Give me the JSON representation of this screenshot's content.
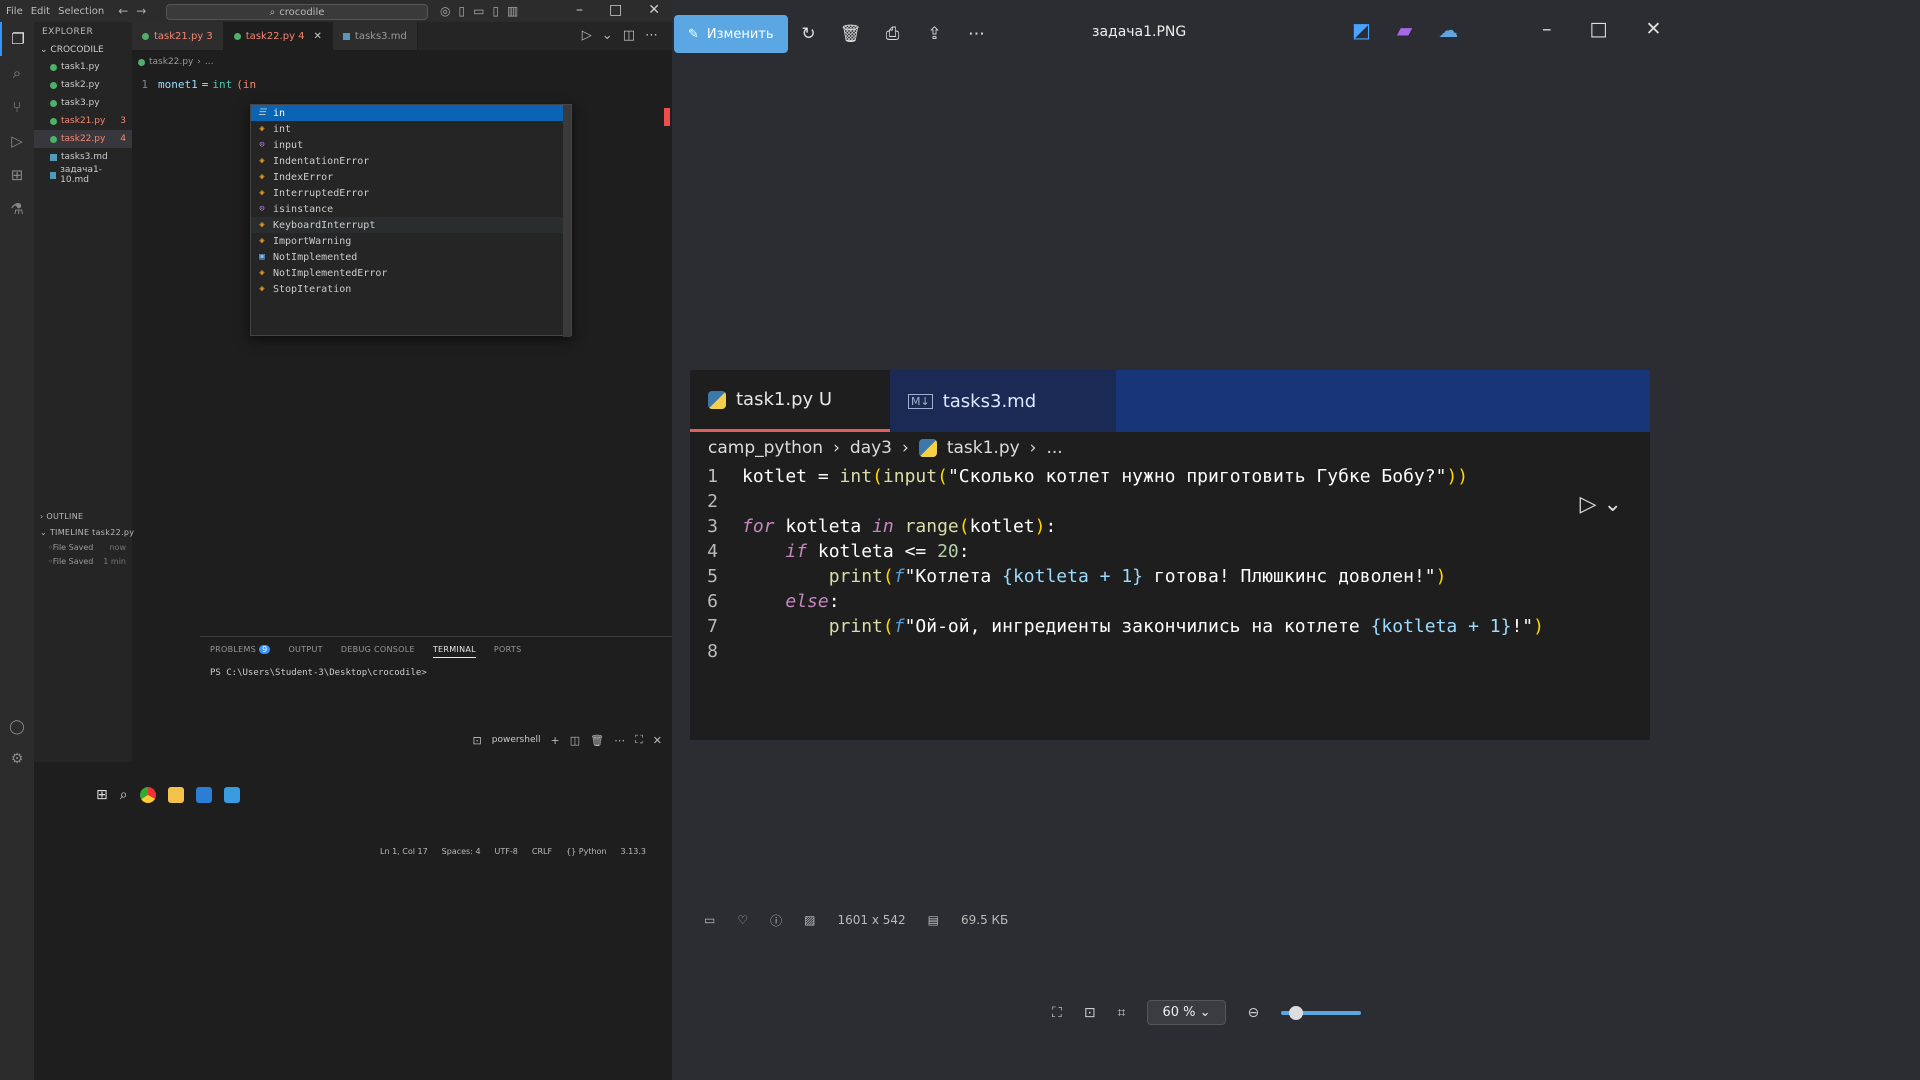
{
  "vscode": {
    "menu": [
      "File",
      "Edit",
      "Selection"
    ],
    "command_center": "crocodile",
    "explorer_header": "EXPLORER",
    "folder_name": "CROCODILE",
    "files": [
      {
        "name": "task1.py",
        "kind": "py",
        "state": "normal",
        "badge": ""
      },
      {
        "name": "task2.py",
        "kind": "py",
        "state": "normal",
        "badge": ""
      },
      {
        "name": "task3.py",
        "kind": "py",
        "state": "normal",
        "badge": ""
      },
      {
        "name": "task21.py",
        "kind": "py",
        "state": "err",
        "badge": "3"
      },
      {
        "name": "task22.py",
        "kind": "py",
        "state": "active-err",
        "badge": "4"
      },
      {
        "name": "tasks3.md",
        "kind": "md",
        "state": "normal",
        "badge": ""
      },
      {
        "name": "задача1-10.md",
        "kind": "md",
        "state": "normal",
        "badge": ""
      }
    ],
    "outline_label": "OUTLINE",
    "timeline_label": "TIMELINE",
    "timeline_file": "task22.py",
    "timeline_items": [
      {
        "label": "File Saved",
        "time": "now"
      },
      {
        "label": "File Saved",
        "time": "1 min"
      }
    ],
    "tabs": [
      {
        "label": "task21.py 3",
        "state": "err"
      },
      {
        "label": "task22.py 4",
        "state": "active"
      },
      {
        "label": "tasks3.md",
        "state": "normal"
      }
    ],
    "breadcrumb": [
      "task22.py",
      "..."
    ],
    "code_line": {
      "num": "1",
      "var": "monet1",
      "op": "=",
      "fn": "int",
      "typed": "(in"
    },
    "suggestions": [
      {
        "label": "in",
        "icon": "kw",
        "glyph": "☰"
      },
      {
        "label": "int",
        "icon": "class",
        "glyph": "◈"
      },
      {
        "label": "input",
        "icon": "func",
        "glyph": "⊙"
      },
      {
        "label": "IndentationError",
        "icon": "class",
        "glyph": "◈"
      },
      {
        "label": "IndexError",
        "icon": "class",
        "glyph": "◈"
      },
      {
        "label": "InterruptedError",
        "icon": "class",
        "glyph": "◈"
      },
      {
        "label": "isinstance",
        "icon": "func",
        "glyph": "⊙"
      },
      {
        "label": "KeyboardInterrupt",
        "icon": "class",
        "glyph": "◈"
      },
      {
        "label": "ImportWarning",
        "icon": "class",
        "glyph": "◈"
      },
      {
        "label": "NotImplemented",
        "icon": "const",
        "glyph": "▣"
      },
      {
        "label": "NotImplementedError",
        "icon": "class",
        "glyph": "◈"
      },
      {
        "label": "StopIteration",
        "icon": "class",
        "glyph": "◈"
      }
    ],
    "panel_tabs": [
      "PROBLEMS",
      "OUTPUT",
      "DEBUG CONSOLE",
      "TERMINAL",
      "PORTS"
    ],
    "problems_count": "9",
    "terminal_prompt": "PS C:\\Users\\Student-3\\Desktop\\crocodile>",
    "terminal_shell": "powershell",
    "status": [
      "Ln 1, Col 17",
      "Spaces: 4",
      "UTF-8",
      "CRLF",
      "{} Python",
      "3.13.3"
    ]
  },
  "viewer": {
    "edit_label": "Изменить",
    "title": "задача1.PNG",
    "image_tabs": [
      {
        "label": "task1.py U",
        "active": true
      },
      {
        "label": "tasks3.md",
        "active": false
      }
    ],
    "image_breadcrumb": [
      "camp_python",
      "day3",
      "task1.py",
      "..."
    ],
    "code_lines": [
      {
        "n": "1",
        "segments": [
          [
            "nm",
            "kotlet "
          ],
          [
            "nm",
            "= "
          ],
          [
            "bi",
            "int"
          ],
          [
            "br",
            "("
          ],
          [
            "bi",
            "input"
          ],
          [
            "br",
            "("
          ],
          [
            "st",
            "\"Сколько котлет нужно приготовить Губке Бобу?\""
          ],
          [
            "br",
            "))"
          ]
        ]
      },
      {
        "n": "2",
        "segments": []
      },
      {
        "n": "3",
        "segments": [
          [
            "kw",
            "for "
          ],
          [
            "nm",
            "kotleta "
          ],
          [
            "kw",
            "in "
          ],
          [
            "bi",
            "range"
          ],
          [
            "br",
            "("
          ],
          [
            "nm",
            "kotlet"
          ],
          [
            "br",
            ")"
          ],
          [
            "nm",
            ":"
          ]
        ]
      },
      {
        "n": "4",
        "segments": [
          [
            "ind",
            "    "
          ],
          [
            "kw",
            "if "
          ],
          [
            "nm",
            "kotleta "
          ],
          [
            "nm",
            "<= "
          ],
          [
            "num",
            "20"
          ],
          [
            "nm",
            ":"
          ]
        ]
      },
      {
        "n": "5",
        "segments": [
          [
            "ind",
            "        "
          ],
          [
            "bi",
            "print"
          ],
          [
            "br",
            "("
          ],
          [
            "fx",
            "f"
          ],
          [
            "st",
            "\"Котлета "
          ],
          [
            "ib",
            "{kotleta + 1}"
          ],
          [
            "st",
            " готова! Плюшкинс доволен!\""
          ],
          [
            "br",
            ")"
          ]
        ]
      },
      {
        "n": "6",
        "segments": [
          [
            "ind",
            "    "
          ],
          [
            "kw",
            "else"
          ],
          [
            "nm",
            ":"
          ]
        ]
      },
      {
        "n": "7",
        "segments": [
          [
            "ind",
            "        "
          ],
          [
            "bi",
            "print"
          ],
          [
            "br",
            "("
          ],
          [
            "fx",
            "f"
          ],
          [
            "st",
            "\"Ой-ой, ингредиенты закончились на котлете "
          ],
          [
            "ib",
            "{kotleta + 1}"
          ],
          [
            "st",
            "!\""
          ],
          [
            "br",
            ")"
          ]
        ]
      },
      {
        "n": "8",
        "segments": []
      }
    ],
    "dimensions": "1601 x 542",
    "file_size": "69.5 КБ",
    "zoom": "60 %"
  }
}
